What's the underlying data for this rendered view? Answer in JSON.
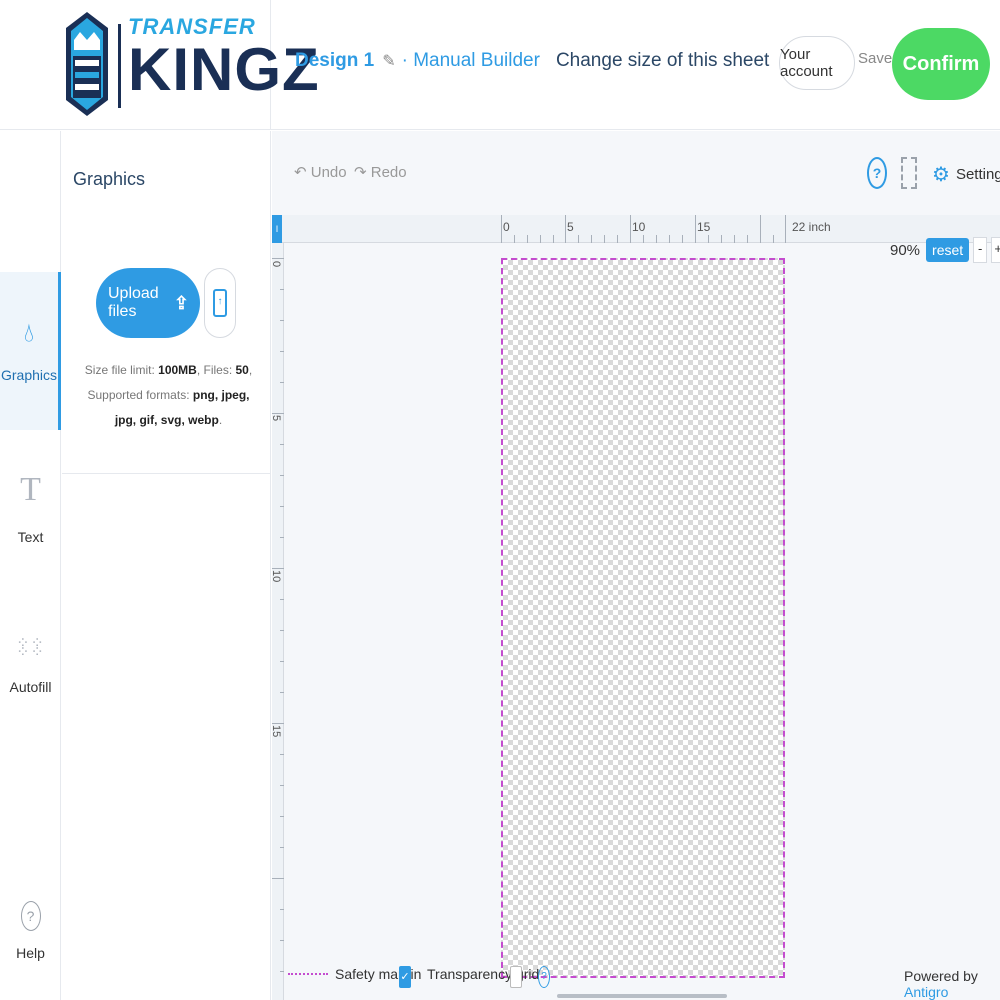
{
  "brand": {
    "logo_text_top": "TRANSFER",
    "logo_text_bottom": "KINGZ",
    "crest_text": "TRANSFER KINGZ",
    "colors": {
      "primary": "#2f9be3",
      "navy": "#1a2f55",
      "confirm": "#4cd964",
      "safety": "#c44ccf"
    }
  },
  "header": {
    "design_name": "Design 1",
    "edit_icon": "pencil-icon",
    "builder_label": "· Manual Builder",
    "change_size": "Change size of this sheet",
    "account_label": "Your account",
    "save_label": "Save",
    "confirm_label": "Confirm"
  },
  "nav": {
    "items": [
      {
        "label": "Graphics",
        "icon": "drop-icon"
      },
      {
        "label": "Text",
        "icon": "text-t-icon"
      },
      {
        "label": "Autofill",
        "icon": "grid-dots-icon"
      }
    ],
    "help_label": "Help",
    "help_icon": "question-icon"
  },
  "panel": {
    "title": "Graphics",
    "upload_label": "Upload files",
    "limits_prefix": "Size file limit: ",
    "size_limit": "100MB",
    "files_prefix": ", Files: ",
    "files_limit": "50",
    "formats_prefix": ", Supported formats: ",
    "formats": "png, jpeg, jpg, gif, svg, webp",
    "formats_suffix": "."
  },
  "toolbar": {
    "undo_label": "Undo",
    "redo_label": "Redo",
    "settings_label": "Settings"
  },
  "ruler": {
    "horizontal_labels": [
      "0",
      "5",
      "10",
      "15",
      "22 inch"
    ],
    "vertical_labels": [
      "0",
      "5",
      "10",
      "15"
    ]
  },
  "zoom": {
    "level": "90%",
    "reset_label": "reset",
    "minus_label": "-",
    "plus_label": "+"
  },
  "footer": {
    "safety_label": "Safety margin",
    "safety_checked": true,
    "transparency_label": "Transparency grid",
    "transparency_checked": false,
    "powered_prefix": "Powered by ",
    "powered_brand": "Antigro"
  }
}
